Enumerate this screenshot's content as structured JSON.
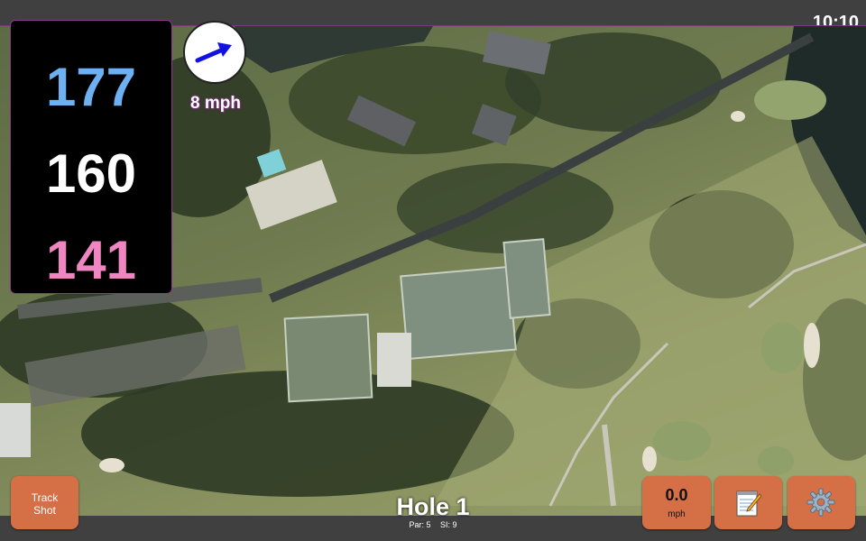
{
  "status": {
    "time": "10:10"
  },
  "distances": {
    "back": "177",
    "middle": "160",
    "front": "141"
  },
  "wind": {
    "speed_label": "8 mph",
    "icon": "wind-direction-arrow-icon"
  },
  "hole": {
    "title": "Hole 1",
    "par_label": "Par: 5",
    "si_label": "SI: 9"
  },
  "buttons": {
    "track_shot_line1": "Track",
    "track_shot_line2": "Shot",
    "speed_value": "0.0",
    "speed_unit": "mph",
    "notes_icon": "notepad-icon",
    "settings_icon": "gear-icon"
  },
  "colors": {
    "button": "#d56f45",
    "back_distance": "#6db1f2",
    "middle_distance": "#ffffff",
    "front_distance": "#ef86c1",
    "panel_border": "#8a3c8a",
    "wind_arrow": "#1212e0"
  }
}
